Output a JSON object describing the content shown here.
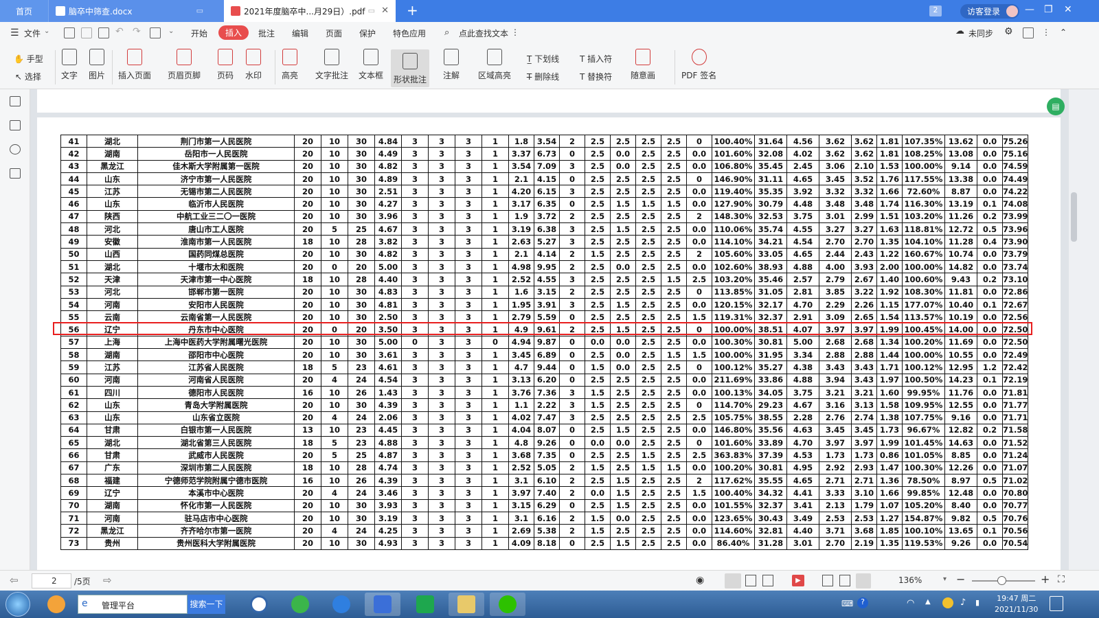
{
  "tabs": {
    "home": "首页",
    "doc": "脑卒中筛查.docx",
    "pdf": "2021年度脑卒中...月29日）.pdf",
    "count": "2",
    "visitor": "访客登录"
  },
  "menu": {
    "file": "文件",
    "items": [
      "开始",
      "插入",
      "批注",
      "编辑",
      "页面",
      "保护",
      "特色应用"
    ],
    "active": "插入",
    "search": "点此查找文本",
    "sync": "未同步"
  },
  "toolbar": {
    "hand": "手型",
    "select": "选择",
    "text": "文字",
    "image": "图片",
    "insert_page": "插入页面",
    "header_footer": "页眉页脚",
    "page_num": "页码",
    "watermark": "水印",
    "highlight": "高亮",
    "text_comment": "文字批注",
    "textbox": "文本框",
    "shape_comment": "形状批注",
    "note": "注解",
    "area_highlight": "区域高亮",
    "underline": "下划线",
    "strikethrough": "删除线",
    "insert_char": "插入符",
    "replace_char": "替换符",
    "freehand": "随意画",
    "pdf_sign": "PDF 签名"
  },
  "table": {
    "rows": [
      [
        "41",
        "湖北",
        "荆门市第一人民医院",
        "20",
        "10",
        "30",
        "4.84",
        "3",
        "3",
        "3",
        "1",
        "1.8",
        "3.54",
        "2",
        "2.5",
        "2.5",
        "2.5",
        "2.5",
        "0",
        "100.40%",
        "31.64",
        "4.56",
        "3.62",
        "3.62",
        "1.81",
        "107.35%",
        "13.62",
        "0.0",
        "75.26"
      ],
      [
        "42",
        "湖南",
        "岳阳市一人民医院",
        "20",
        "10",
        "30",
        "4.49",
        "3",
        "3",
        "3",
        "1",
        "3.37",
        "6.73",
        "0",
        "2.5",
        "0.0",
        "2.5",
        "2.5",
        "0.0",
        "101.60%",
        "32.08",
        "4.02",
        "3.62",
        "3.62",
        "1.81",
        "108.25%",
        "13.08",
        "0.0",
        "75.16"
      ],
      [
        "43",
        "黑龙江",
        "佳木斯大学附属第一医院",
        "20",
        "10",
        "30",
        "4.82",
        "3",
        "3",
        "3",
        "1",
        "3.54",
        "7.09",
        "3",
        "2.5",
        "0.0",
        "2.5",
        "2.5",
        "0.0",
        "106.80%",
        "35.45",
        "2.45",
        "3.06",
        "2.10",
        "1.53",
        "100.00%",
        "9.14",
        "0.0",
        "74.59"
      ],
      [
        "44",
        "山东",
        "济宁市第一人民医院",
        "20",
        "10",
        "30",
        "4.89",
        "3",
        "3",
        "3",
        "1",
        "2.1",
        "4.15",
        "0",
        "2.5",
        "2.5",
        "2.5",
        "2.5",
        "0",
        "146.90%",
        "31.11",
        "4.65",
        "3.45",
        "3.52",
        "1.76",
        "117.55%",
        "13.38",
        "0.0",
        "74.49"
      ],
      [
        "45",
        "江苏",
        "无锡市第二人民医院",
        "20",
        "10",
        "30",
        "2.51",
        "3",
        "3",
        "3",
        "1",
        "4.20",
        "6.15",
        "3",
        "2.5",
        "2.5",
        "2.5",
        "2.5",
        "0.0",
        "119.40%",
        "35.35",
        "3.92",
        "3.32",
        "3.32",
        "1.66",
        "72.60%",
        "8.87",
        "0.0",
        "74.22"
      ],
      [
        "46",
        "山东",
        "临沂市人民医院",
        "20",
        "10",
        "30",
        "4.27",
        "3",
        "3",
        "3",
        "1",
        "3.17",
        "6.35",
        "0",
        "2.5",
        "1.5",
        "1.5",
        "1.5",
        "0.0",
        "127.90%",
        "30.79",
        "4.48",
        "3.48",
        "3.48",
        "1.74",
        "116.30%",
        "13.19",
        "0.1",
        "74.08"
      ],
      [
        "47",
        "陕西",
        "中航工业三二〇一医院",
        "20",
        "10",
        "30",
        "3.96",
        "3",
        "3",
        "3",
        "1",
        "1.9",
        "3.72",
        "2",
        "2.5",
        "2.5",
        "2.5",
        "2.5",
        "2",
        "148.30%",
        "32.53",
        "3.75",
        "3.01",
        "2.99",
        "1.51",
        "103.20%",
        "11.26",
        "0.2",
        "73.99"
      ],
      [
        "48",
        "河北",
        "唐山市工人医院",
        "20",
        "5",
        "25",
        "4.67",
        "3",
        "3",
        "3",
        "1",
        "3.19",
        "6.38",
        "3",
        "2.5",
        "1.5",
        "2.5",
        "2.5",
        "0.0",
        "110.06%",
        "35.74",
        "4.55",
        "3.27",
        "3.27",
        "1.63",
        "118.81%",
        "12.72",
        "0.5",
        "73.96"
      ],
      [
        "49",
        "安徽",
        "淮南市第一人民医院",
        "18",
        "10",
        "28",
        "3.82",
        "3",
        "3",
        "3",
        "1",
        "2.63",
        "5.27",
        "3",
        "2.5",
        "2.5",
        "2.5",
        "2.5",
        "0.0",
        "114.10%",
        "34.21",
        "4.54",
        "2.70",
        "2.70",
        "1.35",
        "104.10%",
        "11.28",
        "0.4",
        "73.90"
      ],
      [
        "50",
        "山西",
        "国药同煤总医院",
        "20",
        "10",
        "30",
        "4.82",
        "3",
        "3",
        "3",
        "1",
        "2.1",
        "4.14",
        "2",
        "1.5",
        "2.5",
        "2.5",
        "2.5",
        "2",
        "105.60%",
        "33.05",
        "4.65",
        "2.44",
        "2.43",
        "1.22",
        "160.67%",
        "10.74",
        "0.0",
        "73.79"
      ],
      [
        "51",
        "湖北",
        "十堰市太和医院",
        "20",
        "0",
        "20",
        "5.00",
        "3",
        "3",
        "3",
        "1",
        "4.98",
        "9.95",
        "2",
        "2.5",
        "0.0",
        "2.5",
        "2.5",
        "0.0",
        "102.60%",
        "38.93",
        "4.88",
        "4.00",
        "3.93",
        "2.00",
        "100.00%",
        "14.82",
        "0.0",
        "73.74"
      ],
      [
        "52",
        "天津",
        "天津市第一中心医院",
        "18",
        "10",
        "28",
        "4.40",
        "3",
        "3",
        "3",
        "1",
        "2.52",
        "4.55",
        "3",
        "2.5",
        "2.5",
        "2.5",
        "1.5",
        "2.5",
        "103.20%",
        "35.46",
        "2.57",
        "2.79",
        "2.67",
        "1.40",
        "100.60%",
        "9.43",
        "0.2",
        "73.10"
      ],
      [
        "53",
        "河北",
        "邯郸市第一医院",
        "20",
        "10",
        "30",
        "4.83",
        "3",
        "3",
        "3",
        "1",
        "1.6",
        "3.15",
        "2",
        "2.5",
        "2.5",
        "2.5",
        "2.5",
        "0",
        "113.85%",
        "31.05",
        "2.81",
        "3.85",
        "3.22",
        "1.92",
        "108.30%",
        "11.81",
        "0.0",
        "72.86"
      ],
      [
        "54",
        "河南",
        "安阳市人民医院",
        "20",
        "10",
        "30",
        "4.81",
        "3",
        "3",
        "3",
        "1",
        "1.95",
        "3.91",
        "3",
        "2.5",
        "1.5",
        "2.5",
        "2.5",
        "0.0",
        "120.15%",
        "32.17",
        "4.70",
        "2.29",
        "2.26",
        "1.15",
        "177.07%",
        "10.40",
        "0.1",
        "72.67"
      ],
      [
        "55",
        "云南",
        "云南省第一人民医院",
        "20",
        "10",
        "30",
        "2.50",
        "3",
        "3",
        "3",
        "1",
        "2.79",
        "5.59",
        "0",
        "2.5",
        "2.5",
        "2.5",
        "2.5",
        "1.5",
        "119.31%",
        "32.37",
        "2.91",
        "3.09",
        "2.65",
        "1.54",
        "113.57%",
        "10.19",
        "0.0",
        "72.56"
      ],
      [
        "56",
        "辽宁",
        "丹东市中心医院",
        "20",
        "0",
        "20",
        "3.50",
        "3",
        "3",
        "3",
        "1",
        "4.9",
        "9.61",
        "2",
        "2.5",
        "1.5",
        "2.5",
        "2.5",
        "0",
        "100.00%",
        "38.51",
        "4.07",
        "3.97",
        "3.97",
        "1.99",
        "100.45%",
        "14.00",
        "0.0",
        "72.50"
      ],
      [
        "57",
        "上海",
        "上海中医药大学附属曙光医院",
        "20",
        "10",
        "30",
        "5.00",
        "0",
        "3",
        "3",
        "0",
        "4.94",
        "9.87",
        "0",
        "0.0",
        "0.0",
        "2.5",
        "2.5",
        "0.0",
        "100.30%",
        "30.81",
        "5.00",
        "2.68",
        "2.68",
        "1.34",
        "100.20%",
        "11.69",
        "0.0",
        "72.50"
      ],
      [
        "58",
        "湖南",
        "邵阳市中心医院",
        "20",
        "10",
        "30",
        "3.61",
        "3",
        "3",
        "3",
        "1",
        "3.45",
        "6.89",
        "0",
        "2.5",
        "0.0",
        "2.5",
        "1.5",
        "1.5",
        "100.00%",
        "31.95",
        "3.34",
        "2.88",
        "2.88",
        "1.44",
        "100.00%",
        "10.55",
        "0.0",
        "72.49"
      ],
      [
        "59",
        "江苏",
        "江苏省人民医院",
        "18",
        "5",
        "23",
        "4.61",
        "3",
        "3",
        "3",
        "1",
        "4.7",
        "9.44",
        "0",
        "1.5",
        "0.0",
        "2.5",
        "2.5",
        "0",
        "100.12%",
        "35.27",
        "4.38",
        "3.43",
        "3.43",
        "1.71",
        "100.12%",
        "12.95",
        "1.2",
        "72.42"
      ],
      [
        "60",
        "河南",
        "河南省人民医院",
        "20",
        "4",
        "24",
        "4.54",
        "3",
        "3",
        "3",
        "1",
        "3.13",
        "6.20",
        "0",
        "2.5",
        "2.5",
        "2.5",
        "2.5",
        "0.0",
        "211.69%",
        "33.86",
        "4.88",
        "3.94",
        "3.43",
        "1.97",
        "100.50%",
        "14.23",
        "0.1",
        "72.19"
      ],
      [
        "61",
        "四川",
        "德阳市人民医院",
        "16",
        "10",
        "26",
        "1.43",
        "3",
        "3",
        "3",
        "1",
        "3.76",
        "7.36",
        "3",
        "1.5",
        "2.5",
        "2.5",
        "2.5",
        "0.0",
        "100.13%",
        "34.05",
        "3.75",
        "3.21",
        "3.21",
        "1.60",
        "99.95%",
        "11.76",
        "0.0",
        "71.81"
      ],
      [
        "62",
        "山东",
        "青岛大学附属医院",
        "20",
        "10",
        "30",
        "4.39",
        "3",
        "3",
        "3",
        "1",
        "1.1",
        "2.22",
        "3",
        "1.5",
        "2.5",
        "2.5",
        "2.5",
        "0",
        "114.70%",
        "29.23",
        "4.67",
        "3.16",
        "3.13",
        "1.58",
        "109.95%",
        "12.55",
        "0.0",
        "71.77"
      ],
      [
        "63",
        "山东",
        "山东省立医院",
        "20",
        "4",
        "24",
        "2.06",
        "3",
        "3",
        "3",
        "1",
        "4.02",
        "7.47",
        "3",
        "2.5",
        "2.5",
        "2.5",
        "2.5",
        "2.5",
        "105.75%",
        "38.55",
        "2.28",
        "2.76",
        "2.74",
        "1.38",
        "107.75%",
        "9.16",
        "0.0",
        "71.71"
      ],
      [
        "64",
        "甘肃",
        "白银市第一人民医院",
        "13",
        "10",
        "23",
        "4.45",
        "3",
        "3",
        "3",
        "1",
        "4.04",
        "8.07",
        "0",
        "2.5",
        "1.5",
        "2.5",
        "2.5",
        "0.0",
        "146.80%",
        "35.56",
        "4.63",
        "3.45",
        "3.45",
        "1.73",
        "96.67%",
        "12.82",
        "0.2",
        "71.58"
      ],
      [
        "65",
        "湖北",
        "湖北省第三人民医院",
        "18",
        "5",
        "23",
        "4.88",
        "3",
        "3",
        "3",
        "1",
        "4.8",
        "9.26",
        "0",
        "0.0",
        "0.0",
        "2.5",
        "2.5",
        "0",
        "101.60%",
        "33.89",
        "4.70",
        "3.97",
        "3.97",
        "1.99",
        "101.45%",
        "14.63",
        "0.0",
        "71.52"
      ],
      [
        "66",
        "甘肃",
        "武威市人民医院",
        "20",
        "5",
        "25",
        "4.87",
        "3",
        "3",
        "3",
        "1",
        "3.68",
        "7.35",
        "0",
        "2.5",
        "2.5",
        "1.5",
        "2.5",
        "2.5",
        "363.83%",
        "37.39",
        "4.53",
        "1.73",
        "1.73",
        "0.86",
        "101.05%",
        "8.85",
        "0.0",
        "71.24"
      ],
      [
        "67",
        "广东",
        "深圳市第二人民医院",
        "18",
        "10",
        "28",
        "4.74",
        "3",
        "3",
        "3",
        "1",
        "2.52",
        "5.05",
        "2",
        "1.5",
        "2.5",
        "1.5",
        "1.5",
        "0.0",
        "100.20%",
        "30.81",
        "4.95",
        "2.92",
        "2.93",
        "1.47",
        "100.30%",
        "12.26",
        "0.0",
        "71.07"
      ],
      [
        "68",
        "福建",
        "宁德师范学院附属宁德市医院",
        "16",
        "10",
        "26",
        "4.39",
        "3",
        "3",
        "3",
        "1",
        "3.1",
        "6.10",
        "2",
        "2.5",
        "1.5",
        "2.5",
        "2.5",
        "2",
        "117.62%",
        "35.55",
        "4.65",
        "2.71",
        "2.71",
        "1.36",
        "78.50%",
        "8.97",
        "0.5",
        "71.02"
      ],
      [
        "69",
        "辽宁",
        "本溪市中心医院",
        "20",
        "4",
        "24",
        "3.46",
        "3",
        "3",
        "3",
        "1",
        "3.97",
        "7.40",
        "2",
        "0.0",
        "1.5",
        "2.5",
        "2.5",
        "1.5",
        "100.40%",
        "34.32",
        "4.41",
        "3.33",
        "3.10",
        "1.66",
        "99.85%",
        "12.48",
        "0.0",
        "70.80"
      ],
      [
        "70",
        "湖南",
        "怀化市第一人民医院",
        "20",
        "10",
        "30",
        "3.93",
        "3",
        "3",
        "3",
        "1",
        "3.15",
        "6.29",
        "0",
        "2.5",
        "1.5",
        "2.5",
        "2.5",
        "0.0",
        "101.55%",
        "32.37",
        "3.41",
        "2.13",
        "1.79",
        "1.07",
        "105.20%",
        "8.40",
        "0.0",
        "70.77"
      ],
      [
        "71",
        "河南",
        "驻马店市中心医院",
        "20",
        "10",
        "30",
        "3.19",
        "3",
        "3",
        "3",
        "1",
        "3.1",
        "6.16",
        "2",
        "1.5",
        "0.0",
        "2.5",
        "2.5",
        "0.0",
        "123.65%",
        "30.43",
        "3.49",
        "2.53",
        "2.53",
        "1.27",
        "154.87%",
        "9.82",
        "0.5",
        "70.76"
      ],
      [
        "72",
        "黑龙江",
        "齐齐哈尔市第一医院",
        "20",
        "4",
        "24",
        "4.25",
        "3",
        "3",
        "3",
        "1",
        "2.69",
        "5.38",
        "2",
        "1.5",
        "2.5",
        "2.5",
        "2.5",
        "0.0",
        "114.60%",
        "32.81",
        "4.40",
        "3.71",
        "3.68",
        "1.85",
        "100.10%",
        "13.65",
        "0.1",
        "70.56"
      ],
      [
        "73",
        "贵州",
        "贵州医科大学附属医院",
        "20",
        "10",
        "30",
        "4.93",
        "3",
        "3",
        "3",
        "1",
        "4.09",
        "8.18",
        "0",
        "2.5",
        "1.5",
        "2.5",
        "2.5",
        "0.0",
        "86.40%",
        "31.28",
        "3.01",
        "2.70",
        "2.19",
        "1.35",
        "119.53%",
        "9.26",
        "0.0",
        "70.54"
      ]
    ]
  },
  "status": {
    "page": "2",
    "total": "/5页",
    "zoom": "136%"
  },
  "taskbar": {
    "address": "管理平台",
    "search": "搜索一下",
    "time": "19:47 周二",
    "date": "2021/11/30"
  }
}
